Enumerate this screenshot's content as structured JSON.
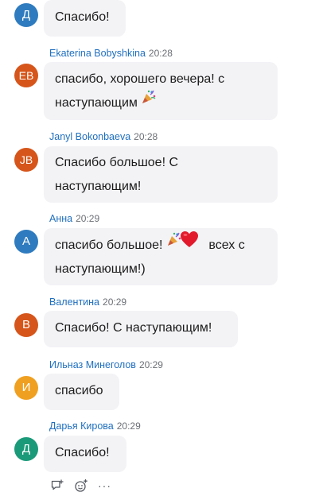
{
  "colors": {
    "author_link": "#1f6fbf",
    "timestamp": "#6b6f75",
    "bubble_bg": "#f3f3f6",
    "avatar_blue": "#2e7bbf",
    "avatar_orange": "#d6551a",
    "avatar_yellow": "#f0a020",
    "avatar_teal": "#1a9a79"
  },
  "messages": [
    {
      "avatar_initials": "Д",
      "text": "Спасибо!"
    },
    {
      "author": "Ekaterina Bobyshkina",
      "time": "20:28",
      "avatar_initials": "EB",
      "text_line1": "спасибо, хорошего вечера! с",
      "text_line2": "наступающим",
      "emoji": "party-popper-icon"
    },
    {
      "author": "Janyl Bokonbaeva",
      "time": "20:28",
      "avatar_initials": "JB",
      "text_line1": "Спасибо большое! С",
      "text_line2": "наступающим!"
    },
    {
      "author": "Анна",
      "time": "20:29",
      "avatar_initials": "А",
      "text_line1_a": "спасибо большое!",
      "text_line1_b": "всех с",
      "text_line2": "наступающим!)",
      "emojis": [
        "party-popper-icon",
        "red-heart-icon"
      ]
    },
    {
      "author": "Валентина",
      "time": "20:29",
      "avatar_initials": "В",
      "text": "Спасибо! С наступающим!"
    },
    {
      "author": "Ильназ Минеголов",
      "time": "20:29",
      "avatar_initials": "И",
      "text": "спасибо"
    },
    {
      "author": "Дарья Кирова",
      "time": "20:29",
      "avatar_initials": "Д",
      "text": "Спасибо!"
    }
  ],
  "actions": {
    "more_label": "···",
    "icons": [
      "reply-in-thread-icon",
      "add-reaction-icon",
      "more-options-icon"
    ]
  }
}
